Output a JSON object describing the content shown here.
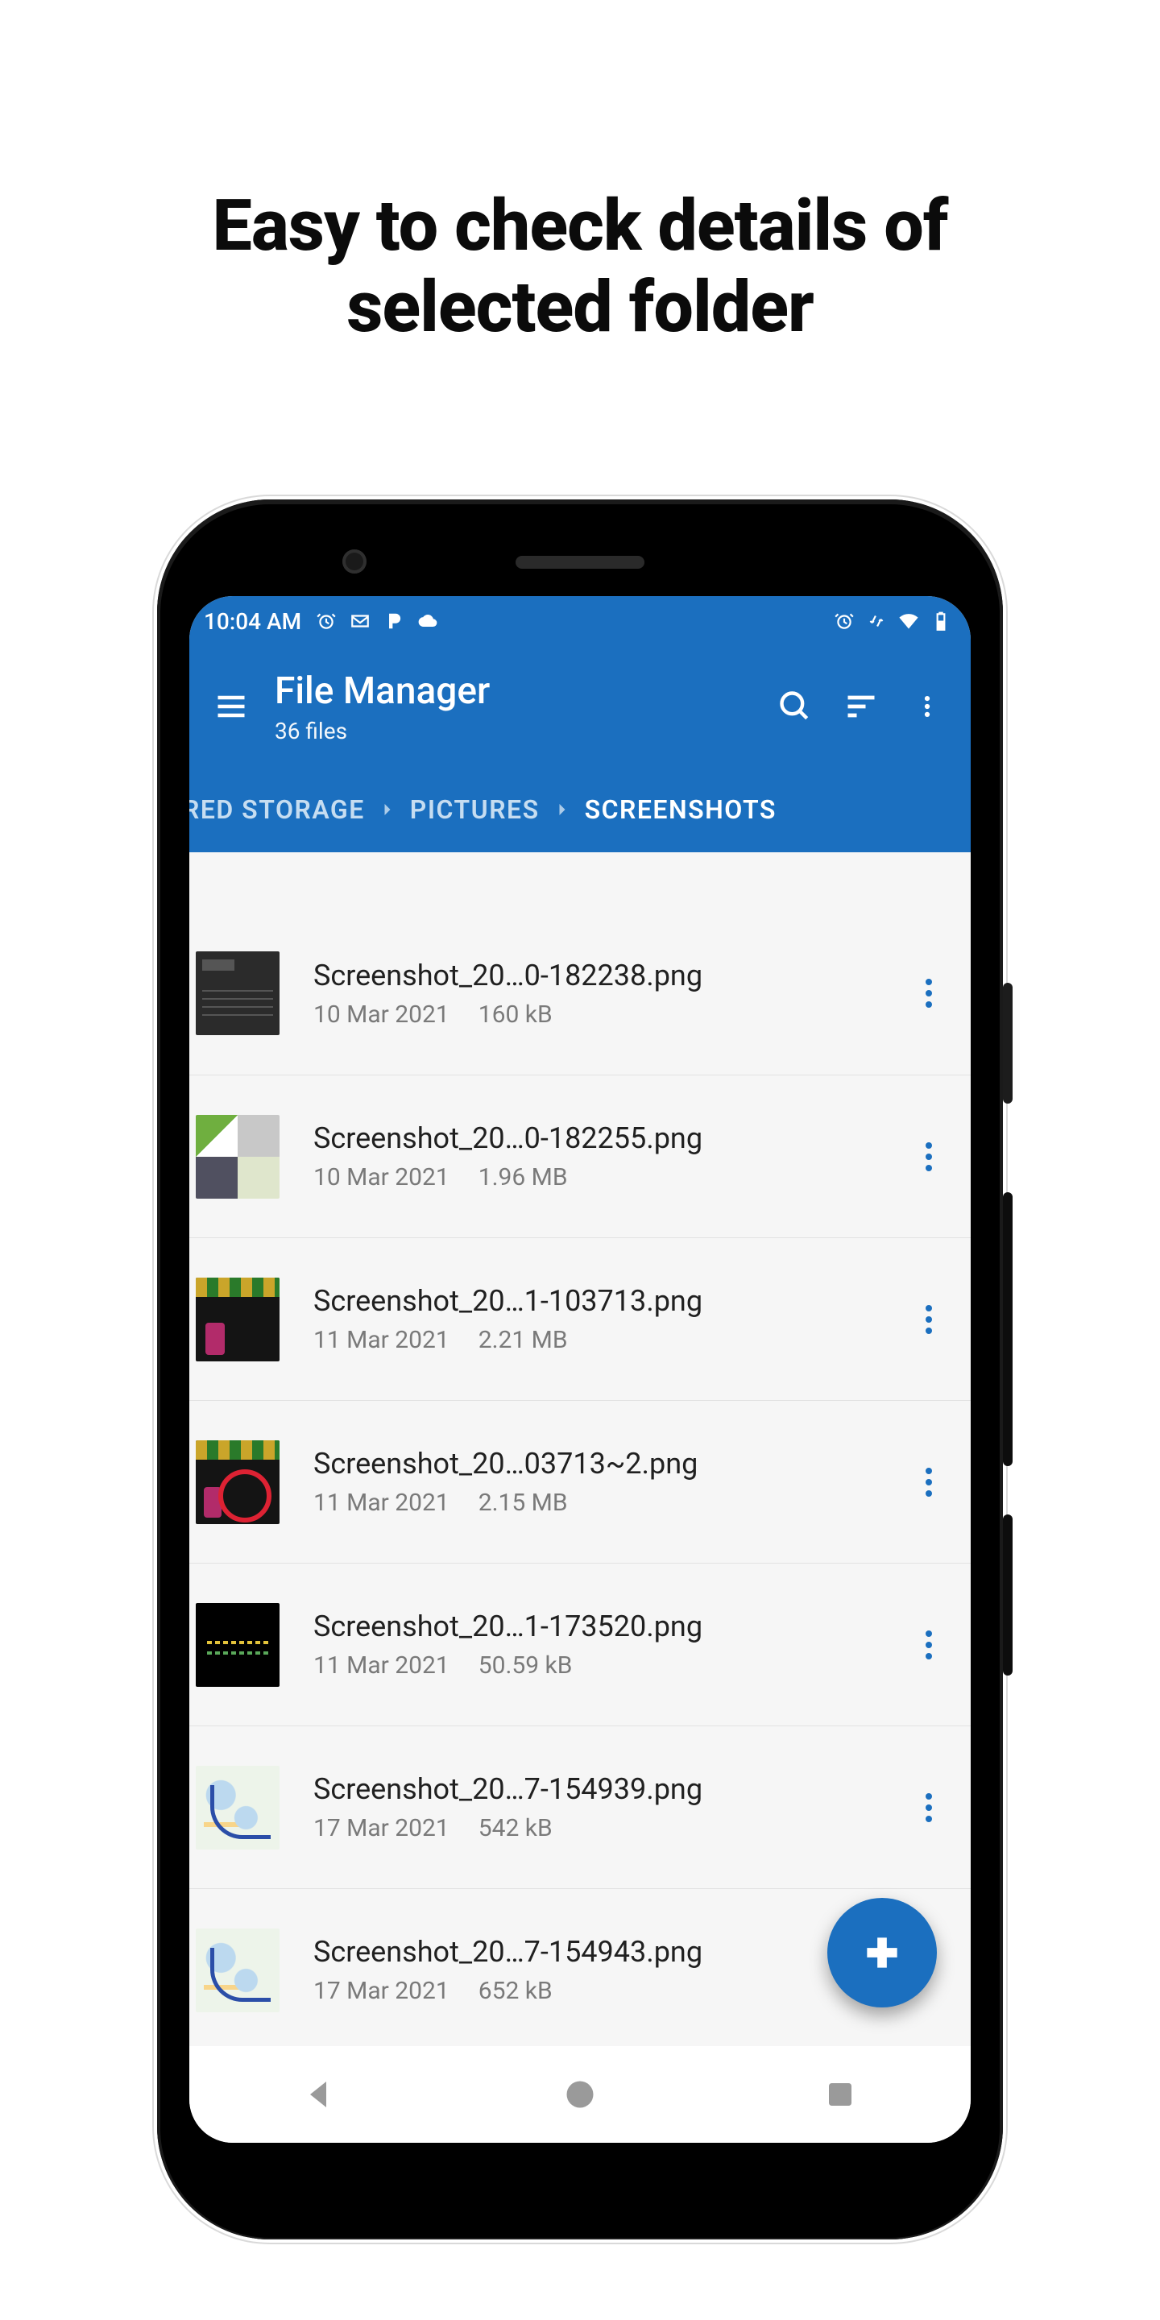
{
  "headline_l1": "Easy to check details of",
  "headline_l2": "selected folder",
  "status": {
    "time": "10:04 AM"
  },
  "appbar": {
    "title": "File Manager",
    "subtitle": "36 files"
  },
  "breadcrumb": [
    {
      "label": "RED STORAGE",
      "active": false
    },
    {
      "label": "PICTURES",
      "active": false
    },
    {
      "label": "SCREENSHOTS",
      "active": true
    }
  ],
  "files": [
    {
      "name": "Screenshot_20…0-182238.png",
      "date": "10 Mar 2021",
      "size": "160 kB",
      "thumb": "th-dark"
    },
    {
      "name": "Screenshot_20…0-182255.png",
      "date": "10 Mar 2021",
      "size": "1.96 MB",
      "thumb": "th-grid"
    },
    {
      "name": "Screenshot_20…1-103713.png",
      "date": "11 Mar 2021",
      "size": "2.21 MB",
      "thumb": "th-band1"
    },
    {
      "name": "Screenshot_20…03713~2.png",
      "date": "11 Mar 2021",
      "size": "2.15 MB",
      "thumb": "th-band2"
    },
    {
      "name": "Screenshot_20…1-173520.png",
      "date": "11 Mar 2021",
      "size": "50.59 kB",
      "thumb": "th-black"
    },
    {
      "name": "Screenshot_20…7-154939.png",
      "date": "17 Mar 2021",
      "size": "542 kB",
      "thumb": "th-map"
    },
    {
      "name": "Screenshot_20…7-154943.png",
      "date": "17 Mar 2021",
      "size": "652 kB",
      "thumb": "th-map"
    }
  ],
  "colors": {
    "primary": "#1b6fbf"
  }
}
